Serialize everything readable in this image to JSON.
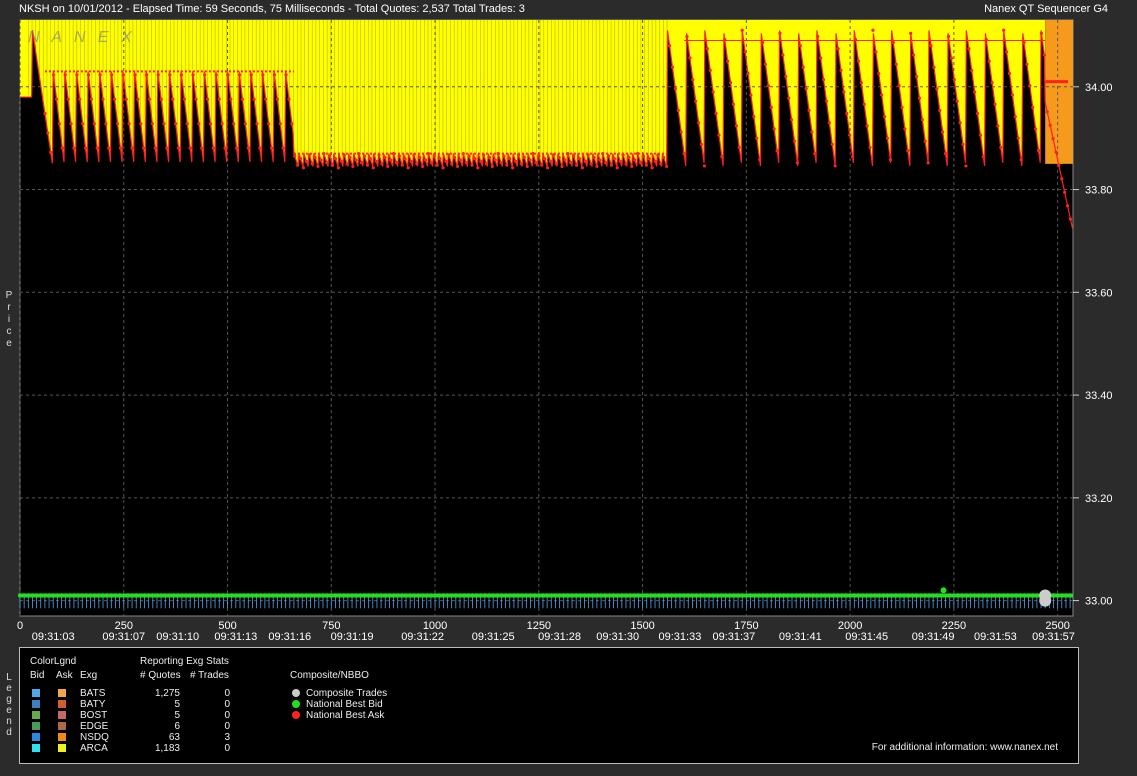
{
  "header": {
    "left": "NKSH on 10/01/2012  -  Elapsed Time: 59 Seconds, 75 Milliseconds  -  Total Quotes: 2,537  Total Trades: 3",
    "right": "Nanex QT Sequencer G4",
    "watermark": "N A N E X"
  },
  "y_axis_label": [
    "P",
    "r",
    "i",
    "c",
    "e"
  ],
  "legend_side_label": [
    "L",
    "e",
    "g",
    "e",
    "n",
    "d"
  ],
  "chart_data": {
    "type": "line",
    "title": "NKSH on 10/01/2012",
    "y_ticks": [
      "34.00",
      "33.80",
      "33.60",
      "33.40",
      "33.20",
      "33.00"
    ],
    "y_tick_values": [
      34.0,
      33.8,
      33.6,
      33.4,
      33.2,
      33.0
    ],
    "ylim": [
      32.97,
      34.13
    ],
    "x_seq_ticks": [
      "0",
      "250",
      "500",
      "750",
      "1000",
      "1250",
      "1500",
      "1750",
      "2000",
      "2250",
      "2500"
    ],
    "x_seq_values": [
      0,
      250,
      500,
      750,
      1000,
      1250,
      1500,
      1750,
      2000,
      2250,
      2500
    ],
    "xlim": [
      0,
      2537
    ],
    "x_time_ticks": [
      {
        "seq": 80,
        "label": "09:31:03"
      },
      {
        "seq": 250,
        "label": "09:31:07"
      },
      {
        "seq": 380,
        "label": "09:31:10"
      },
      {
        "seq": 520,
        "label": "09:31:13"
      },
      {
        "seq": 650,
        "label": "09:31:16"
      },
      {
        "seq": 800,
        "label": "09:31:19"
      },
      {
        "seq": 970,
        "label": "09:31:22"
      },
      {
        "seq": 1140,
        "label": "09:31:25"
      },
      {
        "seq": 1300,
        "label": "09:31:28"
      },
      {
        "seq": 1440,
        "label": "09:31:30"
      },
      {
        "seq": 1590,
        "label": "09:31:33"
      },
      {
        "seq": 1720,
        "label": "09:31:37"
      },
      {
        "seq": 1880,
        "label": "09:31:41"
      },
      {
        "seq": 2040,
        "label": "09:31:45"
      },
      {
        "seq": 2200,
        "label": "09:31:49"
      },
      {
        "seq": 2350,
        "label": "09:31:53"
      },
      {
        "seq": 2490,
        "label": "09:31:57"
      }
    ],
    "series": [
      {
        "name": "National Best Ask",
        "color": "#ff2020",
        "range": [
          33.84,
          34.11
        ],
        "note_levels": {
          "phase1_high": 34.03,
          "phase1_low": 33.84,
          "phase2_high": 33.87,
          "phase3_high": 34.11,
          "final": 33.72
        }
      },
      {
        "name": "National Best Bid",
        "color": "#20e020",
        "level": 33.01
      },
      {
        "name": "Composite Trades",
        "color": "#cccccc",
        "points": [
          {
            "seq": 2470,
            "price": 33.01
          },
          {
            "seq": 2470,
            "price": 33.0
          }
        ]
      }
    ],
    "grid": true,
    "background": "#000000"
  },
  "legend": {
    "headers": {
      "color_legend": "ColorLgnd",
      "bid": "Bid",
      "ask": "Ask",
      "exg": "Exg",
      "reporting": "Reporting Exg Stats",
      "quotes": "# Quotes",
      "trades": "# Trades",
      "composite": "Composite/NBBO"
    },
    "exchanges": [
      {
        "name": "BATS",
        "quotes": "1,275",
        "trades": "0",
        "bid_color": "#4fa8e8",
        "ask_color": "#f0a850"
      },
      {
        "name": "BATY",
        "quotes": "5",
        "trades": "0",
        "bid_color": "#3f7fbf",
        "ask_color": "#d0602a"
      },
      {
        "name": "BOST",
        "quotes": "5",
        "trades": "0",
        "bid_color": "#6aaa4a",
        "ask_color": "#c06a6a"
      },
      {
        "name": "EDGE",
        "quotes": "6",
        "trades": "0",
        "bid_color": "#4a9a5a",
        "ask_color": "#a86a4a"
      },
      {
        "name": "NSDQ",
        "quotes": "63",
        "trades": "3",
        "bid_color": "#2a8adf",
        "ask_color": "#f08a10"
      },
      {
        "name": "ARCA",
        "quotes": "1,183",
        "trades": "0",
        "bid_color": "#30e0f0",
        "ask_color": "#f0f020"
      }
    ],
    "composite": [
      {
        "label": "Composite Trades",
        "color": "#cccccc"
      },
      {
        "label": "National Best Bid",
        "color": "#20e020"
      },
      {
        "label": "National Best Ask",
        "color": "#ff2020"
      }
    ],
    "footer": "For additional information: www.nanex.net"
  }
}
